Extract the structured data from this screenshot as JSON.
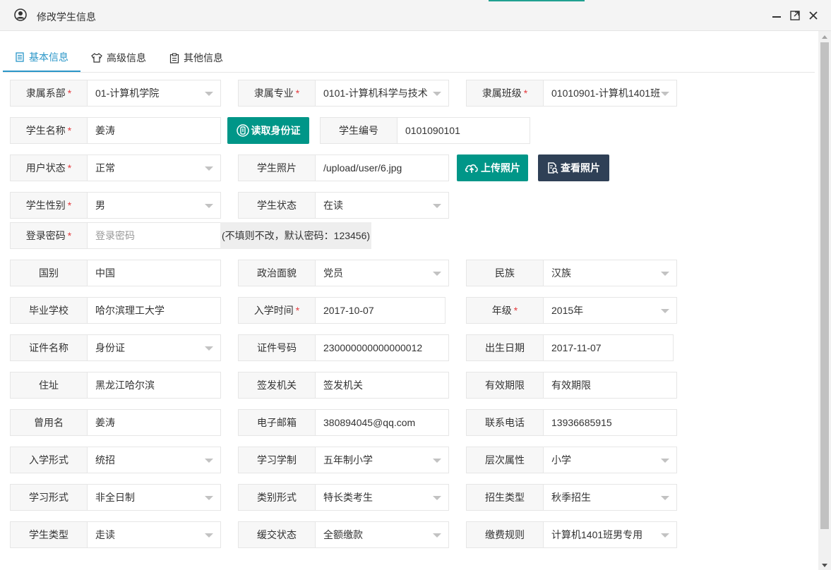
{
  "window": {
    "title": "修改学生信息"
  },
  "tabs": [
    {
      "label": "基本信息",
      "icon": "document-icon"
    },
    {
      "label": "高级信息",
      "icon": "shirt-icon"
    },
    {
      "label": "其他信息",
      "icon": "clipboard-icon"
    }
  ],
  "required_mark": "*",
  "buttons": {
    "read_id": "读取身份证",
    "upload_photo": "上传照片",
    "view_photo": "查看照片"
  },
  "password_hint": "(不填则不改，默认密码：123456)",
  "fields": {
    "dept": {
      "label": "隶属系部",
      "value": "01-计算机学院"
    },
    "major": {
      "label": "隶属专业",
      "value": "0101-计算机科学与技术"
    },
    "class": {
      "label": "隶属班级",
      "value": "01010901-计算机1401班"
    },
    "student_name": {
      "label": "学生名称",
      "value": "姜涛"
    },
    "student_no": {
      "label": "学生编号",
      "value": "0101090101"
    },
    "user_status": {
      "label": "用户状态",
      "value": "正常"
    },
    "photo": {
      "label": "学生照片",
      "value": "/upload/user/6.jpg"
    },
    "gender": {
      "label": "学生性别",
      "value": "男"
    },
    "student_status": {
      "label": "学生状态",
      "value": "在读"
    },
    "password": {
      "label": "登录密码",
      "placeholder": "登录密码"
    },
    "country": {
      "label": "国别",
      "value": "中国"
    },
    "politics": {
      "label": "政治面貌",
      "value": "党员"
    },
    "ethnicity": {
      "label": "民族",
      "value": "汉族"
    },
    "school": {
      "label": "毕业学校",
      "value": "哈尔滨理工大学"
    },
    "enroll_date": {
      "label": "入学时间",
      "value": "2017-10-07"
    },
    "grade": {
      "label": "年级",
      "value": "2015年"
    },
    "id_type": {
      "label": "证件名称",
      "value": "身份证"
    },
    "id_no": {
      "label": "证件号码",
      "value": "230000000000000012"
    },
    "birth": {
      "label": "出生日期",
      "value": "2017-11-07"
    },
    "address": {
      "label": "住址",
      "value": "黑龙江哈尔滨"
    },
    "issuer": {
      "label": "签发机关",
      "value": "签发机关"
    },
    "validity": {
      "label": "有效期限",
      "value": "有效期限"
    },
    "former_name": {
      "label": "曾用名",
      "value": "姜涛"
    },
    "email": {
      "label": "电子邮箱",
      "value": "380894045@qq.com"
    },
    "phone": {
      "label": "联系电话",
      "value": "13936685915"
    },
    "enroll_form": {
      "label": "入学形式",
      "value": "统招"
    },
    "study_system": {
      "label": "学习学制",
      "value": "五年制小学"
    },
    "level": {
      "label": "层次属性",
      "value": "小学"
    },
    "study_form": {
      "label": "学习形式",
      "value": "非全日制"
    },
    "category": {
      "label": "类别形式",
      "value": "特长类考生"
    },
    "recruit_type": {
      "label": "招生类型",
      "value": "秋季招生"
    },
    "student_type": {
      "label": "学生类型",
      "value": "走读"
    },
    "deferral": {
      "label": "缓交状态",
      "value": "全额缴款"
    },
    "fee_rule": {
      "label": "缴费规则",
      "value": "计算机1401班男专用"
    }
  },
  "colors": {
    "accent_blue": "#2a96c8",
    "teal_button": "#009688",
    "dark_button": "#2f4056",
    "required_red": "#e4393c"
  }
}
